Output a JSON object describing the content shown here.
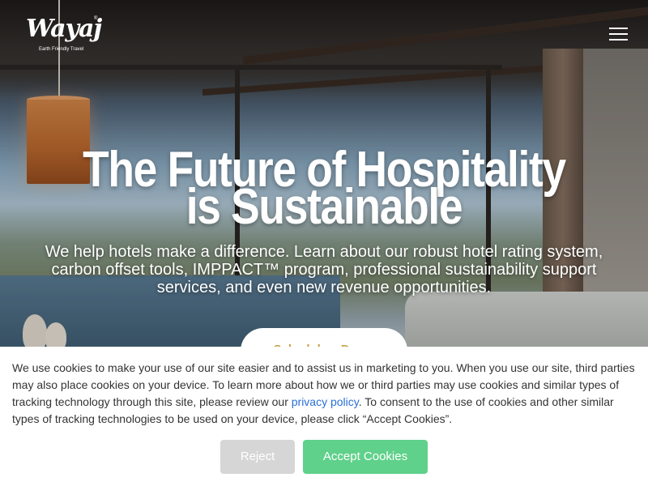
{
  "header": {
    "logo_text": "Wayaj",
    "logo_tagline": "Earth Friendly Travel",
    "logo_reg_mark": "®",
    "menu_icon": "hamburger-menu-icon"
  },
  "hero": {
    "title_line1": "The Future of Hospitality",
    "title_line2": "is Sustainable",
    "subtitle": "We help hotels make a difference. Learn about our robust hotel rating system, carbon offset tools, IMPPACT™ program, professional sustainability support services, and even new revenue opportunities.",
    "cta_label": "Schedule a Demo"
  },
  "cookie_banner": {
    "text_before_link": "We use cookies to make your use of our site easier and to assist us in marketing to you. When you use our site, third parties may also place cookies on your device. To learn more about how we or third parties may use cookies and similar types of tracking technology through this site, please review our ",
    "link_text": "privacy policy",
    "text_after_link": ". To consent to the use of cookies and other similar types of tracking technologies to be used on your device, please click “Accept Cookies”.",
    "reject_label": "Reject",
    "accept_label": "Accept Cookies"
  },
  "colors": {
    "accept_button": "#5fd18a",
    "reject_button": "#d6d6d6",
    "link": "#2a6fd6",
    "cta_text": "#c8a24a"
  }
}
